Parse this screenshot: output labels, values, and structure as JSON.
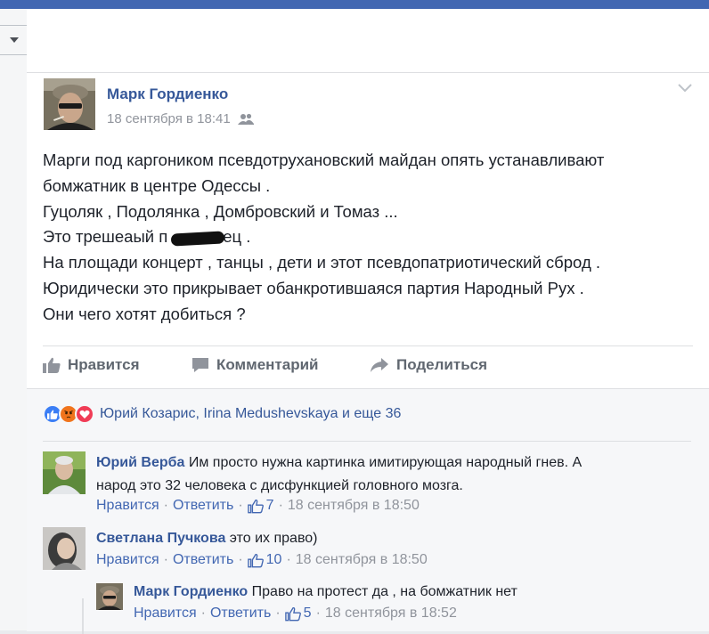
{
  "post": {
    "author": "Марк Гордиенко",
    "date": "18 сентября в 18:41",
    "lines": [
      "Марги под каргоником псевдотрухановский майдан опять устанавливают",
      "бомжатник в центре Одессы .",
      "Гуцоляк , Подолянка , Домбровский и Томаз ...",
      "Это трешеаый п",
      "ец .",
      "На площади концерт , танцы , дети и этот псевдопатриотический сброд .",
      "Юридически это прикрывает обанкротившаяся партия Народный Рух .",
      "Они чего хотят добиться ?"
    ]
  },
  "actions": {
    "like": "Нравится",
    "comment": "Комментарий",
    "share": "Поделиться"
  },
  "reactions": {
    "text": "Юрий Козарис, Irina Medushevskaya и еще 36"
  },
  "comments": [
    {
      "name": "Юрий Верба",
      "text_line1": "Им просто нужна картинка имитирующая народный гнев. А",
      "text_line2": "народ это 32 человека с дисфункцией головного мозга.",
      "like_label": "Нравится",
      "reply_label": "Ответить",
      "likes": "7",
      "time": "18 сентября в 18:50"
    },
    {
      "name": "Светлана Пучкова",
      "text_line1": "это их право)",
      "like_label": "Нравится",
      "reply_label": "Ответить",
      "likes": "10",
      "time": "18 сентября в 18:50"
    },
    {
      "name": "Марк Гордиенко",
      "text_line1": "Право на протест да , на бомжатник нет",
      "like_label": "Нравится",
      "reply_label": "Ответить",
      "likes": "5",
      "time": "18 сентября в 18:52"
    }
  ],
  "colors": {
    "link": "#365899",
    "meta": "#90949c",
    "like_blue": "#4267b2"
  }
}
